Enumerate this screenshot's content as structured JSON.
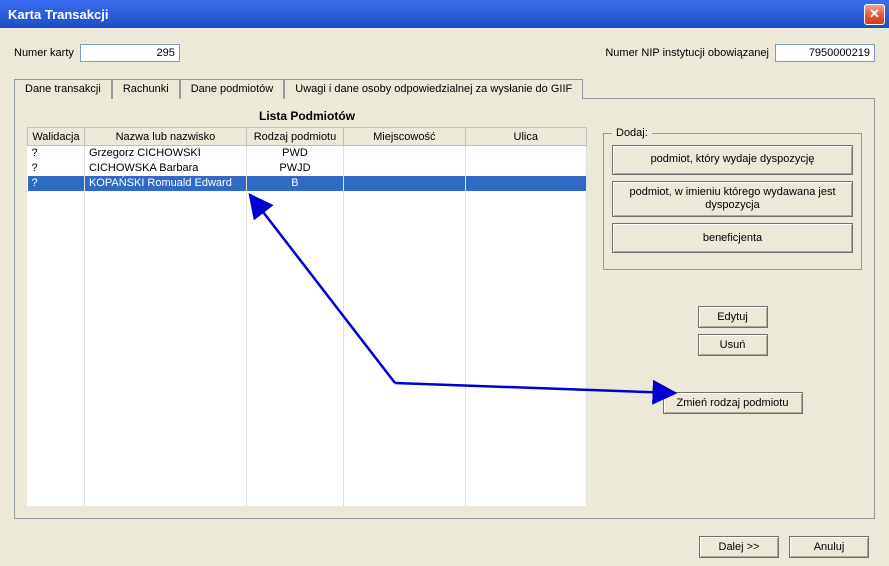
{
  "window": {
    "title": "Karta Transakcji"
  },
  "top": {
    "numer_karty_label": "Numer karty",
    "numer_karty_value": "295",
    "nip_label": "Numer NIP instytucji obowiązanej",
    "nip_value": "7950000219"
  },
  "tabs": {
    "t0": "Dane transakcji",
    "t1": "Rachunki",
    "t2": "Dane podmiotów",
    "t3": "Uwagi i dane osoby odpowiedzialnej za wysłanie do GIIF"
  },
  "list": {
    "title": "Lista Podmiotów",
    "headers": {
      "walidacja": "Walidacja",
      "nazwa": "Nazwa lub nazwisko",
      "rodzaj": "Rodzaj podmiotu",
      "miejscowosc": "Miejscowość",
      "ulica": "Ulica"
    },
    "rows": [
      {
        "walidacja": "?",
        "nazwa": "Grzegorz CICHOWSKI",
        "rodzaj": "PWD",
        "miejscowosc": "",
        "ulica": ""
      },
      {
        "walidacja": "?",
        "nazwa": "CICHOWSKA Barbara",
        "rodzaj": "PWJD",
        "miejscowosc": "",
        "ulica": ""
      },
      {
        "walidacja": "?",
        "nazwa": "KOPAŃSKI Romuald Edward",
        "rodzaj": "B",
        "miejscowosc": "",
        "ulica": ""
      }
    ]
  },
  "side": {
    "dodaj_legend": "Dodaj:",
    "btn_wydaje": "podmiot, który wydaje dyspozycję",
    "btn_imieniu": "podmiot, w imieniu którego wydawana jest dyspozycja",
    "btn_benef": "beneficjenta",
    "btn_edytuj": "Edytuj",
    "btn_usun": "Usuń",
    "btn_zmien": "Zmień rodzaj podmiotu"
  },
  "bottom": {
    "dalej": "Dalej >>",
    "anuluj": "Anuluj"
  }
}
